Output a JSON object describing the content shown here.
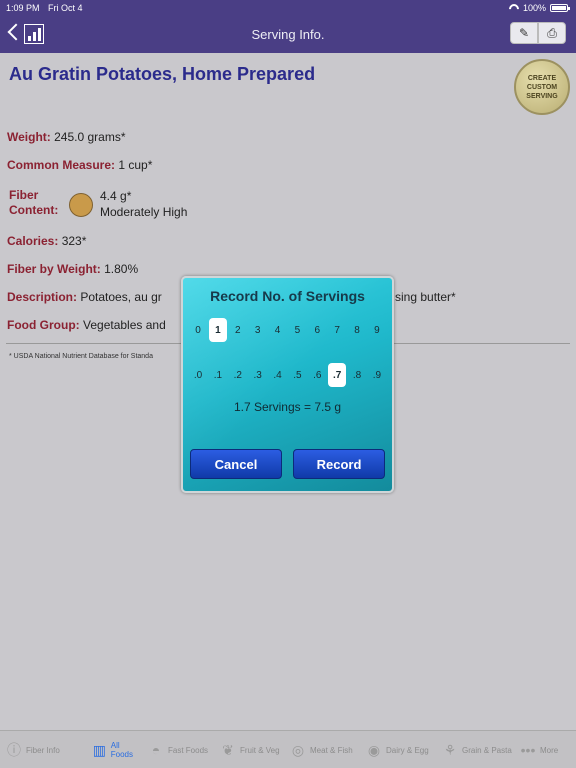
{
  "status": {
    "time": "1:09 PM",
    "date": "Fri Oct 4",
    "battery": "100%"
  },
  "nav": {
    "title": "Serving Info."
  },
  "food": {
    "title": "Au Gratin Potatoes, Home Prepared",
    "custom_seal": "CREATE CUSTOM SERVING",
    "weight_label": "Weight:",
    "weight_value": "245.0 grams*",
    "measure_label": "Common Measure:",
    "measure_value": "1 cup*",
    "fiber_label_1": "Fiber",
    "fiber_label_2": "Content:",
    "fiber_value": "4.4 g*",
    "fiber_level": "Moderately High",
    "fiber_color": "#c99a4a",
    "calories_label": "Calories:",
    "calories_value": "323*",
    "fiber_weight_label": "Fiber by Weight:",
    "fiber_weight_value": "1.80%",
    "description_label": "Description:",
    "description_value": "Potatoes, au gr",
    "description_tail": "sing butter*",
    "group_label": "Food Group:",
    "group_value": "Vegetables and",
    "source": "* USDA National Nutrient Database for Standa"
  },
  "modal": {
    "title": "Record No. of Servings",
    "whole": [
      "0",
      "1",
      "2",
      "3",
      "4",
      "5",
      "6",
      "7",
      "8",
      "9"
    ],
    "whole_selected": "1",
    "fraction": [
      ".0",
      ".1",
      ".2",
      ".3",
      ".4",
      ".5",
      ".6",
      ".7",
      ".8",
      ".9"
    ],
    "fraction_selected": ".7",
    "summary": "1.7 Servings = 7.5 g",
    "cancel_label": "Cancel",
    "record_label": "Record"
  },
  "tabs": [
    {
      "label": "Fiber Info",
      "icon": "info-icon"
    },
    {
      "label": "All Foods",
      "icon": "chart-icon",
      "active": true
    },
    {
      "label": "Fast Foods",
      "icon": "burger-icon"
    },
    {
      "label": "Fruit & Veg",
      "icon": "fruit-icon"
    },
    {
      "label": "Meat & Fish",
      "icon": "fish-icon"
    },
    {
      "label": "Dairy & Egg",
      "icon": "egg-icon"
    },
    {
      "label": "Grain & Pasta",
      "icon": "wheat-icon"
    },
    {
      "label": "More",
      "icon": "more-icon"
    }
  ]
}
